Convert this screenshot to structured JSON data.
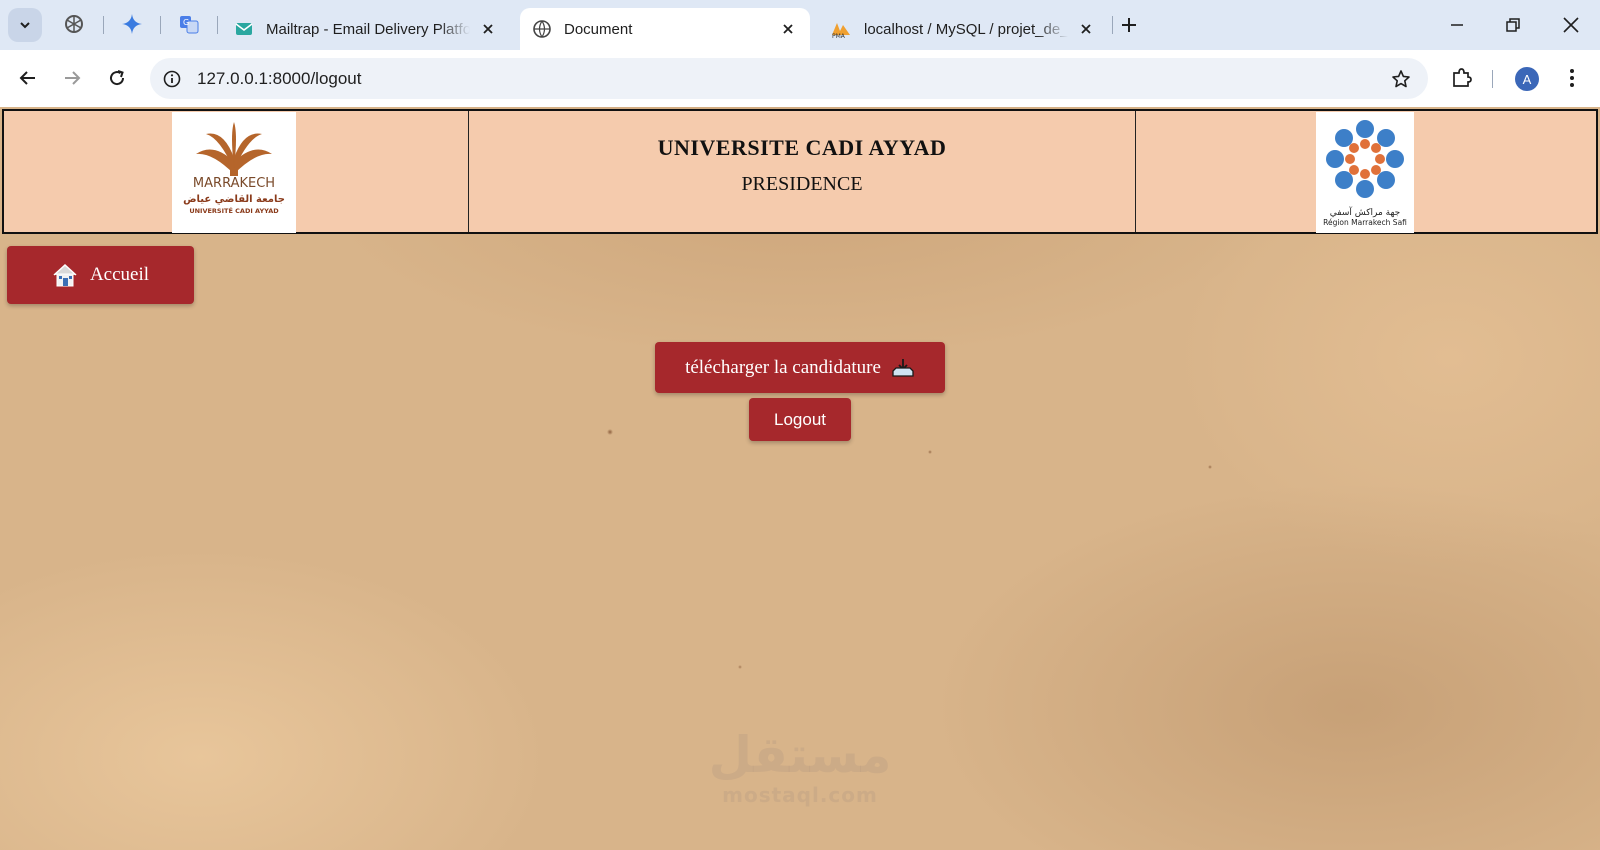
{
  "browser": {
    "tabs": [
      {
        "title": "Mailtrap - Email Delivery Platform",
        "active": false
      },
      {
        "title": "Document",
        "active": true
      },
      {
        "title": "localhost / MySQL / projet_de_stage",
        "active": false
      }
    ],
    "url": "127.0.0.1:8000/logout",
    "profile_initial": "A"
  },
  "header": {
    "left_logo": {
      "name": "MARRAKECH",
      "arabic": "جامعة القاضي عياض",
      "subtitle": "UNIVERSITÉ CADI AYYAD"
    },
    "title": "UNIVERSITE CADI AYYAD",
    "subtitle": "PRESIDENCE",
    "right_logo": {
      "arabic": "جهة مراكش آسفي",
      "subtitle": "Région Marrakech Safi"
    }
  },
  "buttons": {
    "home": "Accueil",
    "download": "télécharger la candidature",
    "logout": "Logout"
  },
  "watermark": {
    "arabic": "مستقل",
    "latin": "mostaql.com"
  },
  "colors": {
    "accent": "#a6282c",
    "header_bg": "#f5cbad",
    "paper": "#d8b48a"
  }
}
